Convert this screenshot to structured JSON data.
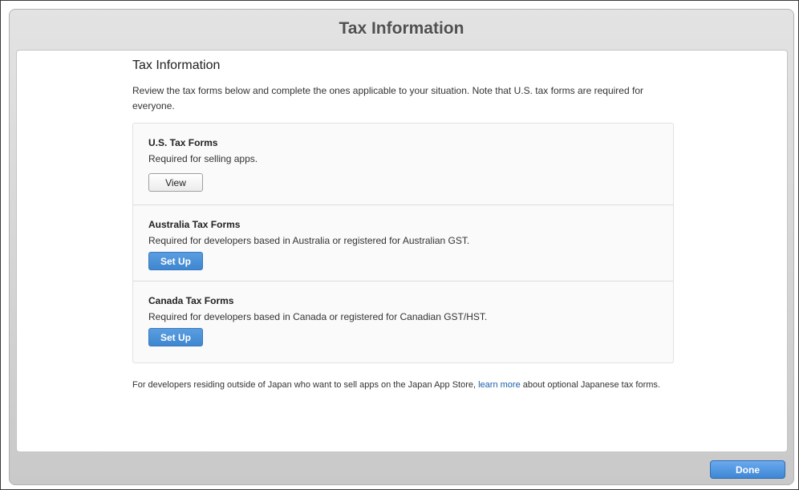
{
  "window": {
    "title": "Tax Information"
  },
  "main": {
    "heading": "Tax Information",
    "intro": "Review the tax forms below and complete the ones applicable to your situation. Note that U.S. tax forms are required for everyone.",
    "sections": [
      {
        "title": "U.S. Tax Forms",
        "description": "Required for selling apps.",
        "button_label": "View"
      },
      {
        "title": "Australia Tax Forms",
        "description": "Required for developers based in Australia or registered for Australian GST.",
        "button_label": "Set Up"
      },
      {
        "title": "Canada Tax Forms",
        "description": "Required for developers based in Canada or registered for Canadian GST/HST.",
        "button_label": "Set Up"
      }
    ],
    "footer": {
      "text_before": "For developers residing outside of Japan who want to sell apps on the Japan App Store, ",
      "link": "learn more",
      "text_after": " about optional Japanese tax forms."
    }
  },
  "actions": {
    "done_label": "Done"
  },
  "colors": {
    "accent": "#3f86d0",
    "link": "#1a5fa8"
  }
}
